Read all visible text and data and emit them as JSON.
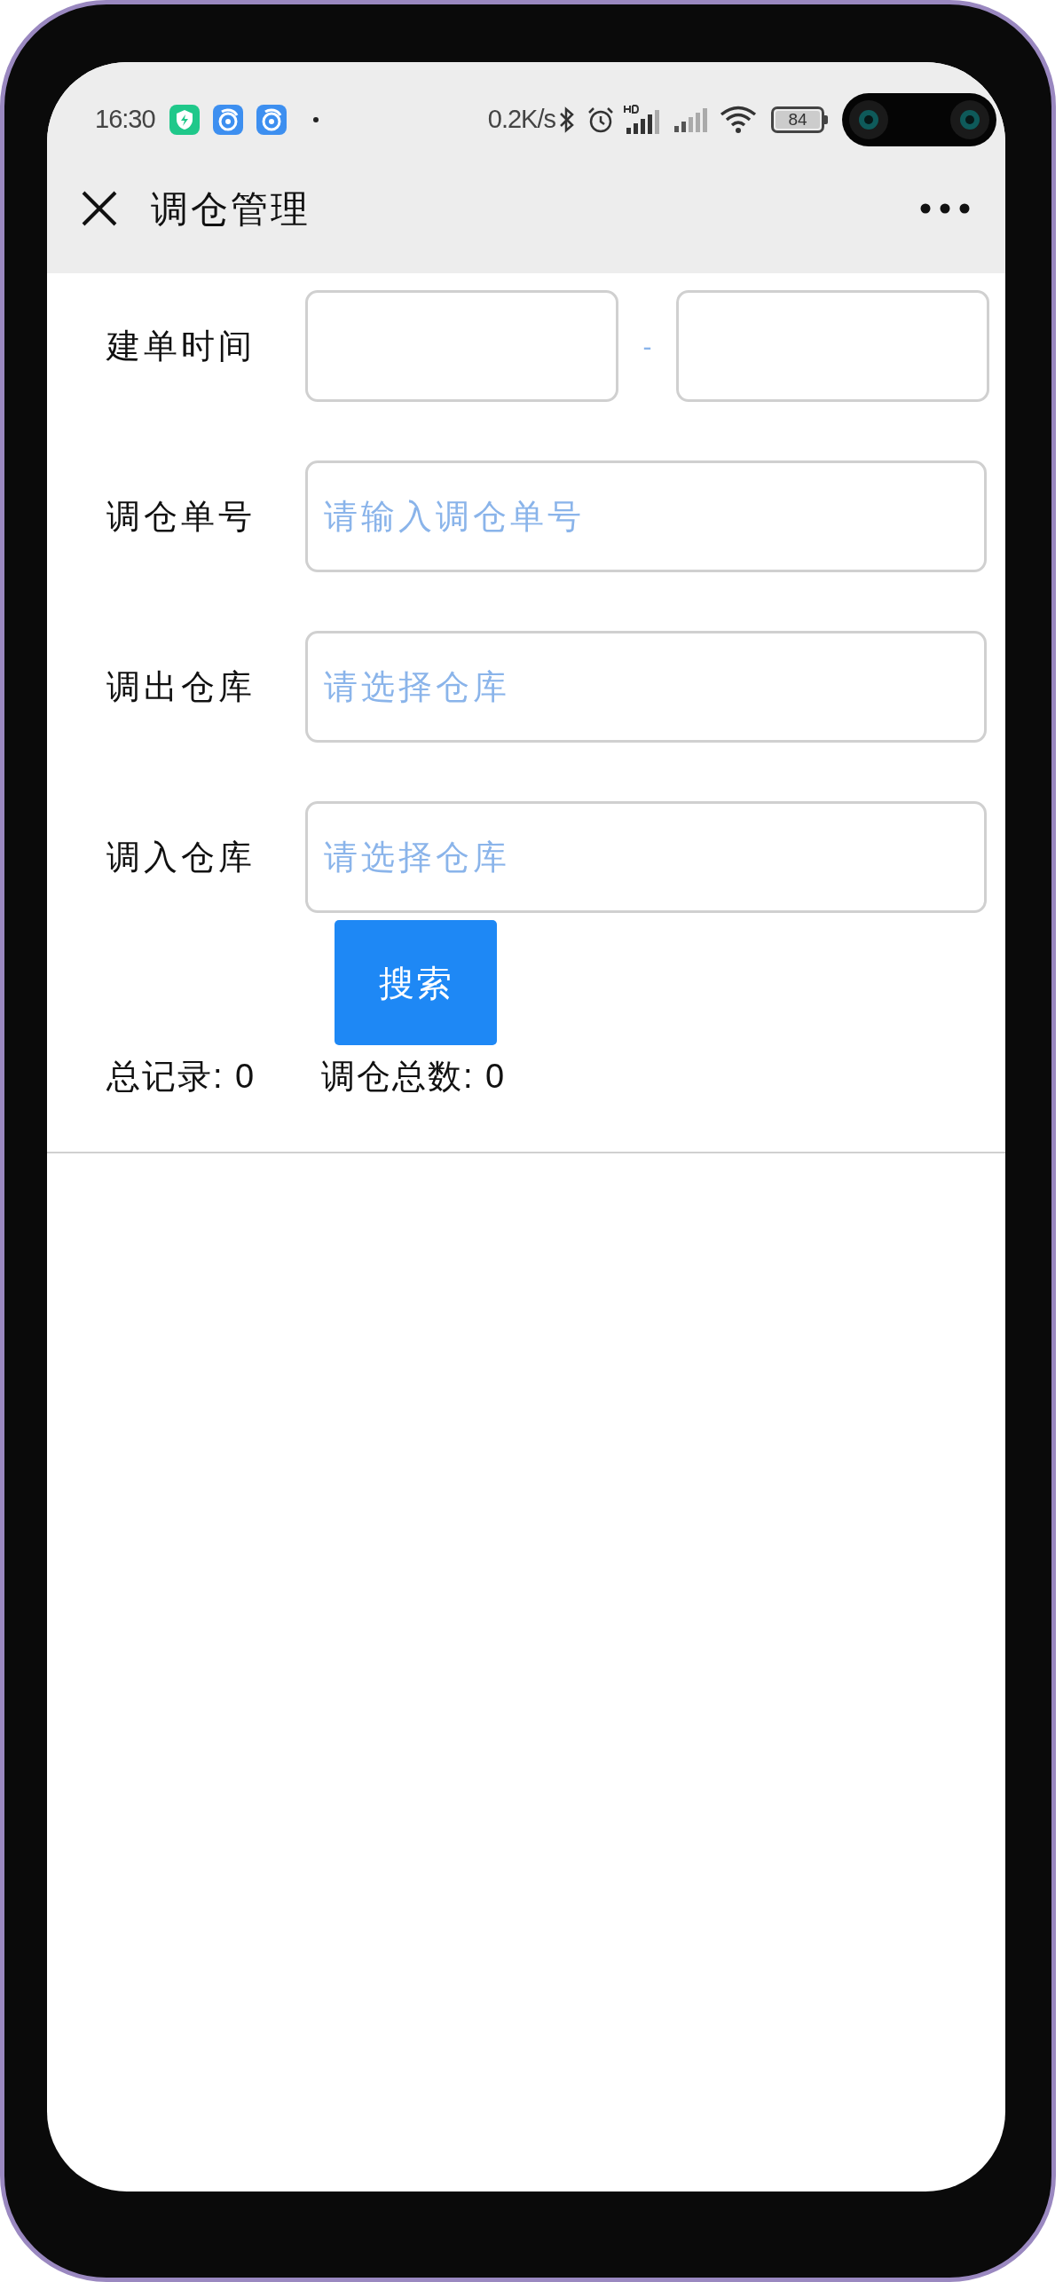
{
  "status_bar": {
    "time": "16:30",
    "net_speed": "0.2K/s",
    "battery": "84"
  },
  "title_bar": {
    "title": "调仓管理"
  },
  "form": {
    "fields": [
      {
        "kind": "date_range",
        "label": "建单时间",
        "separator": "-"
      },
      {
        "kind": "text",
        "label": "调仓单号",
        "placeholder": "请输入调仓单号"
      },
      {
        "kind": "select",
        "label": "调出仓库",
        "placeholder": "请选择仓库"
      },
      {
        "kind": "select",
        "label": "调入仓库",
        "placeholder": "请选择仓库"
      }
    ],
    "search_button": "搜索"
  },
  "totals": [
    "总记录: 0",
    "调仓总数: 0"
  ]
}
